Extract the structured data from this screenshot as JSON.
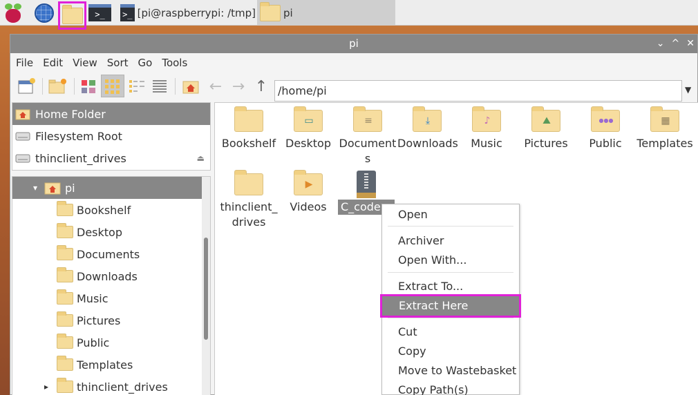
{
  "taskbar": {
    "terminal_task": "[pi@raspberrypi: /tmp]",
    "files_task": "pi",
    "terminal_prompt": ">_"
  },
  "window": {
    "title": "pi",
    "controls": [
      "⌄",
      "^",
      "✕"
    ]
  },
  "menubar": [
    "File",
    "Edit",
    "View",
    "Sort",
    "Go",
    "Tools"
  ],
  "path": "/home/pi",
  "places": [
    {
      "label": "Home Folder",
      "icon": "home-icon",
      "selected": true
    },
    {
      "label": "Filesystem Root",
      "icon": "drive-icon"
    },
    {
      "label": "thinclient_drives",
      "icon": "drive-icon",
      "eject": "⏏"
    }
  ],
  "tree": [
    {
      "label": "pi",
      "icon": "home-icon",
      "expander": "▾"
    },
    {
      "label": "Bookshelf"
    },
    {
      "label": "Desktop"
    },
    {
      "label": "Documents"
    },
    {
      "label": "Downloads"
    },
    {
      "label": "Music"
    },
    {
      "label": "Pictures"
    },
    {
      "label": "Public"
    },
    {
      "label": "Templates"
    },
    {
      "label": "thinclient_drives",
      "expander": "▸"
    }
  ],
  "files": [
    {
      "name": "Bookshelf",
      "emblem": ""
    },
    {
      "name": "Desktop",
      "emblem": "▭"
    },
    {
      "name": "Document\ns",
      "emblem": "≡"
    },
    {
      "name": "Downloads",
      "emblem": "⤓"
    },
    {
      "name": "Music",
      "emblem": "♪"
    },
    {
      "name": "Pictures",
      "emblem": "⛰"
    },
    {
      "name": "Public",
      "emblem": "●●●"
    },
    {
      "name": "Templates",
      "emblem": "▦"
    },
    {
      "name": "thinclient_\ndrives",
      "emblem": ""
    },
    {
      "name": "Videos",
      "emblem": "▶"
    },
    {
      "name": "C_code.z",
      "emblem": ""
    }
  ],
  "context_menu": {
    "open": "Open",
    "archiver": "Archiver",
    "open_with": "Open With...",
    "extract_to": "Extract To...",
    "extract_here": "Extract Here",
    "cut": "Cut",
    "copy": "Copy",
    "move_to_wastebasket": "Move to Wastebasket",
    "copy_paths": "Copy Path(s)"
  },
  "colors": {
    "selection": "#878787",
    "highlight_border": "#e020d8",
    "folder": "#f7dd9f"
  }
}
